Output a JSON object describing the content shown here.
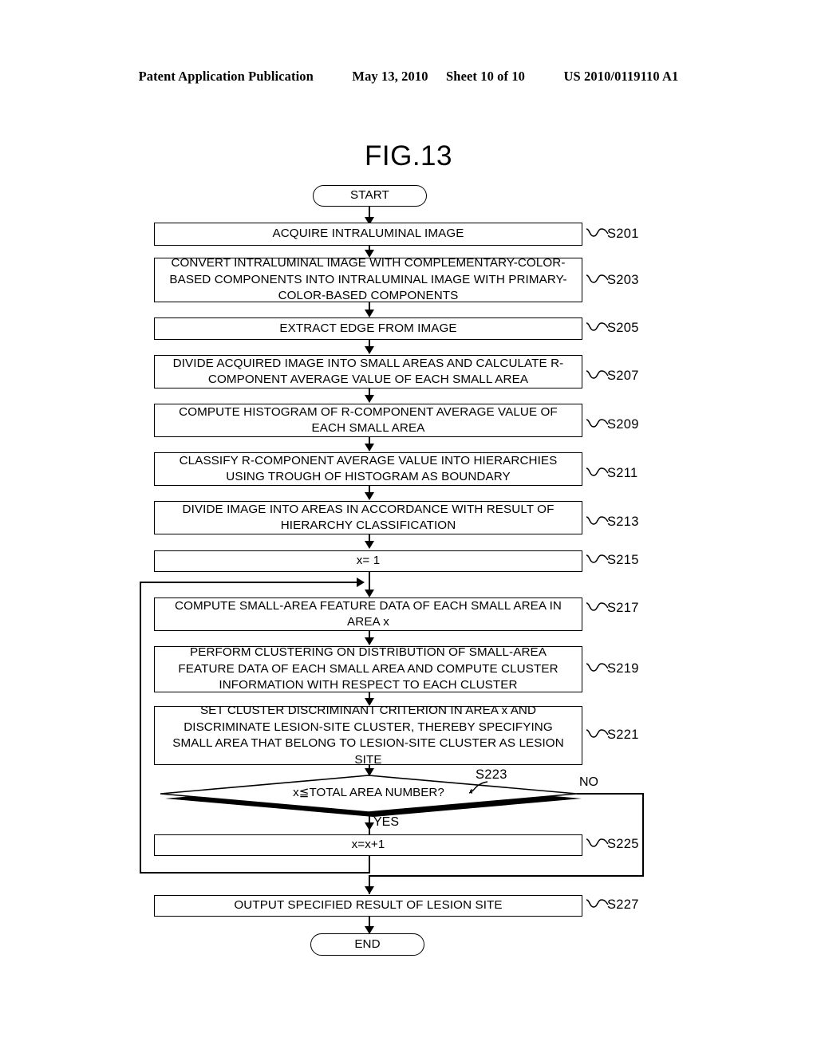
{
  "header": {
    "publication": "Patent Application Publication",
    "date": "May 13, 2010",
    "sheet": "Sheet 10 of 10",
    "patent_number": "US 2010/0119110 A1"
  },
  "figure": {
    "title": "FIG.13",
    "type": "flowchart"
  },
  "flow": {
    "start_label": "START",
    "end_label": "END",
    "steps": [
      {
        "ref": "S201",
        "text": "ACQUIRE INTRALUMINAL IMAGE"
      },
      {
        "ref": "S203",
        "text": "CONVERT INTRALUMINAL IMAGE WITH COMPLEMENTARY-COLOR-BASED COMPONENTS INTO INTRALUMINAL IMAGE WITH PRIMARY-COLOR-BASED COMPONENTS"
      },
      {
        "ref": "S205",
        "text": "EXTRACT EDGE FROM IMAGE"
      },
      {
        "ref": "S207",
        "text": "DIVIDE ACQUIRED IMAGE INTO SMALL AREAS AND CALCULATE R-COMPONENT AVERAGE VALUE OF EACH SMALL AREA"
      },
      {
        "ref": "S209",
        "text": "COMPUTE HISTOGRAM OF R-COMPONENT AVERAGE VALUE OF EACH SMALL AREA"
      },
      {
        "ref": "S211",
        "text": "CLASSIFY R-COMPONENT AVERAGE VALUE INTO HIERARCHIES USING TROUGH OF HISTOGRAM AS BOUNDARY"
      },
      {
        "ref": "S213",
        "text": "DIVIDE IMAGE INTO AREAS IN ACCORDANCE WITH RESULT OF HIERARCHY CLASSIFICATION"
      },
      {
        "ref": "S215",
        "text": "x= 1"
      },
      {
        "ref": "S217",
        "text": "COMPUTE SMALL-AREA FEATURE DATA OF EACH SMALL AREA IN AREA x"
      },
      {
        "ref": "S219",
        "text": "PERFORM CLUSTERING ON DISTRIBUTION OF SMALL-AREA FEATURE DATA OF EACH SMALL AREA AND COMPUTE CLUSTER INFORMATION WITH RESPECT TO EACH CLUSTER"
      },
      {
        "ref": "S221",
        "text": "SET CLUSTER DISCRIMINANT CRITERION IN AREA x AND DISCRIMINATE LESION-SITE CLUSTER, THEREBY SPECIFYING SMALL AREA THAT BELONG TO LESION-SITE CLUSTER AS LESION SITE"
      },
      {
        "ref": "S225",
        "text": "x=x+1"
      },
      {
        "ref": "S227",
        "text": "OUTPUT SPECIFIED RESULT OF LESION SITE"
      }
    ],
    "decision": {
      "ref": "S223",
      "text": "x≦TOTAL AREA NUMBER?",
      "yes_label": "YES",
      "no_label": "NO"
    }
  }
}
